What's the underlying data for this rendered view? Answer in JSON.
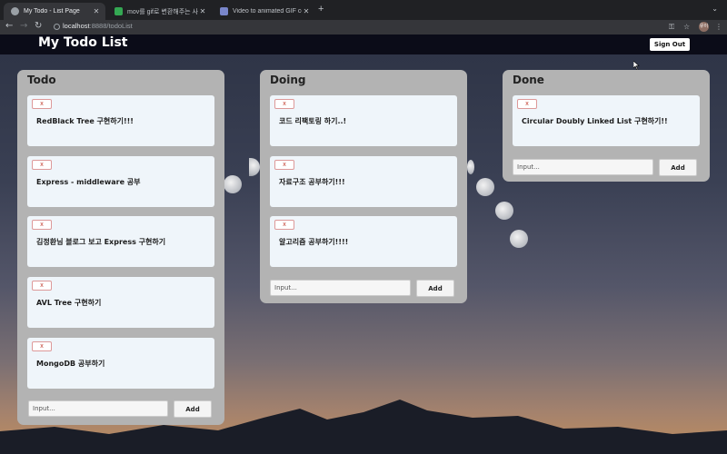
{
  "browser": {
    "tabs": [
      {
        "title": "My Todo - List Page",
        "active": true
      },
      {
        "title": "mov를 gif로 변환해주는 사이트 (..."
      },
      {
        "title": "Video to animated GIF convert..."
      }
    ],
    "url_host": "localhost",
    "url_rest": ":8888/todoList",
    "profile_initials": "유이"
  },
  "app": {
    "title": "My Todo List",
    "sign_out_label": "Sign Out"
  },
  "columns": [
    {
      "title": "Todo",
      "cards": [
        "RedBlack Tree 구현하기!!!",
        "Express - middleware 공부",
        "김정환님 블로그 보고 Express 구현하기",
        "AVL Tree 구현하기",
        "MongoDB 공부하기"
      ],
      "input_placeholder": "Input...",
      "add_label": "Add"
    },
    {
      "title": "Doing",
      "cards": [
        "코드 리팩토링 하기..!",
        "자료구조 공부하기!!!",
        "알고리즘 공부하기!!!!"
      ],
      "input_placeholder": "Input...",
      "add_label": "Add"
    },
    {
      "title": "Done",
      "cards": [
        "Circular Doubly Linked List 구현하기!!"
      ],
      "input_placeholder": "Input...",
      "add_label": "Add"
    }
  ],
  "delete_label": "x",
  "colors": {
    "header": "#0b0c18",
    "column": "#b3b3b3",
    "card": "#eff5fa",
    "delete": "#c0392b"
  }
}
